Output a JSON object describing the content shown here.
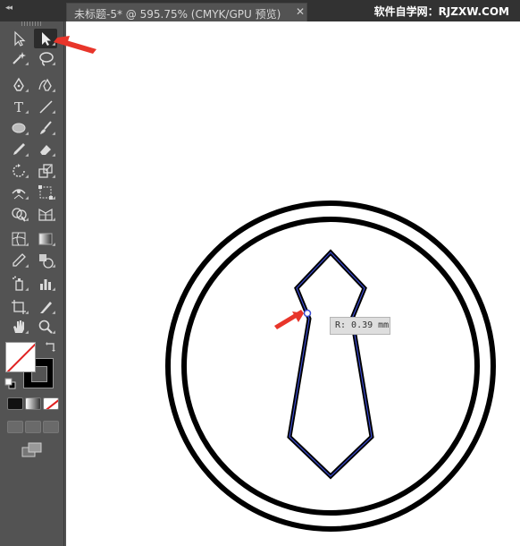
{
  "window": {
    "collapse_glyph": "◂◂",
    "document_tab_title": "未标题-5* @ 595.75% (CMYK/GPU 预览)",
    "document_tab_close": "✕",
    "watermark": "软件自学网：RJZXW.COM"
  },
  "tools_panel": {
    "tools": [
      {
        "name": "selection-tool",
        "icon": "arrow-outline-icon",
        "active": false
      },
      {
        "name": "direct-selection-tool",
        "icon": "arrow-filled-icon",
        "active": true
      },
      {
        "name": "magic-wand-tool",
        "icon": "magic-wand-icon"
      },
      {
        "name": "lasso-tool",
        "icon": "lasso-icon"
      },
      {
        "name": "pen-tool",
        "icon": "pen-icon"
      },
      {
        "name": "curvature-tool",
        "icon": "curvature-pen-icon"
      },
      {
        "name": "type-tool",
        "icon": "type-icon",
        "glyph": "T"
      },
      {
        "name": "line-segment-tool",
        "icon": "line-icon"
      },
      {
        "name": "ellipse-tool",
        "icon": "ellipse-icon"
      },
      {
        "name": "paintbrush-tool",
        "icon": "brush-icon"
      },
      {
        "name": "pencil-tool",
        "icon": "pencil-icon"
      },
      {
        "name": "eraser-tool",
        "icon": "eraser-icon"
      },
      {
        "name": "rotate-tool",
        "icon": "rotate-icon"
      },
      {
        "name": "scale-tool",
        "icon": "scale-icon"
      },
      {
        "name": "width-tool",
        "icon": "width-icon"
      },
      {
        "name": "free-transform-tool",
        "icon": "free-transform-icon"
      },
      {
        "name": "shape-builder-tool",
        "icon": "shape-builder-icon"
      },
      {
        "name": "perspective-grid-tool",
        "icon": "perspective-grid-icon"
      },
      {
        "name": "mesh-tool",
        "icon": "mesh-icon"
      },
      {
        "name": "gradient-tool",
        "icon": "gradient-icon"
      },
      {
        "name": "eyedropper-tool",
        "icon": "eyedropper-icon"
      },
      {
        "name": "blend-tool",
        "icon": "blend-icon"
      },
      {
        "name": "symbol-sprayer-tool",
        "icon": "symbol-sprayer-icon"
      },
      {
        "name": "column-graph-tool",
        "icon": "column-graph-icon"
      },
      {
        "name": "artboard-tool",
        "icon": "artboard-icon"
      },
      {
        "name": "slice-tool",
        "icon": "slice-icon"
      },
      {
        "name": "hand-tool",
        "icon": "hand-icon"
      },
      {
        "name": "zoom-tool",
        "icon": "zoom-icon"
      }
    ],
    "fill_color": "#ffffff",
    "stroke_color": "#000000",
    "none_indicator_color": "#e02020"
  },
  "canvas": {
    "readout_text": "R: 0.39 mm",
    "artwork_stroke_color": "#000000",
    "path_highlight_color": "#3b4bd0",
    "annotation_arrow_color": "#e8352a"
  }
}
